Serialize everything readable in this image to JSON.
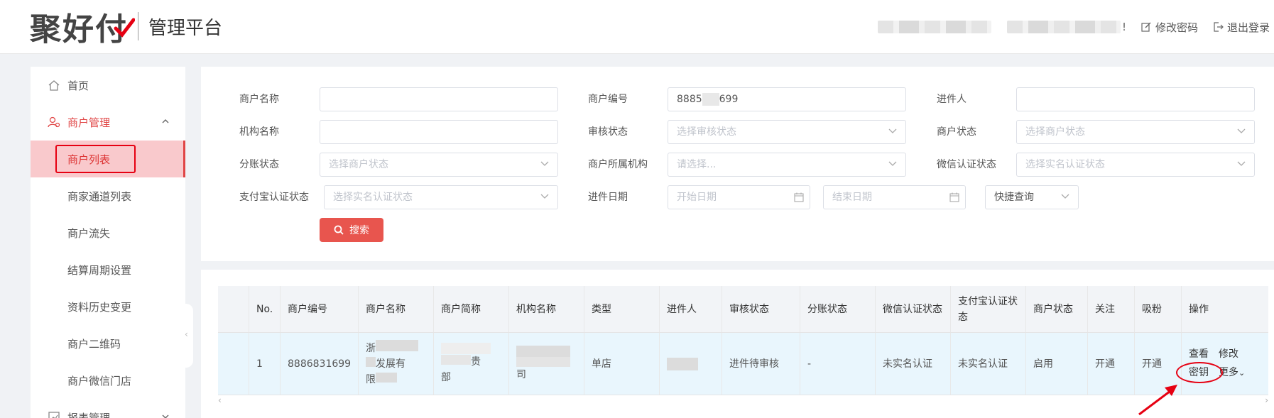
{
  "header": {
    "logo_text": "聚好付",
    "platform_title": "管理平台",
    "greeting_suffix": "!",
    "change_password": "修改密码",
    "logout": "退出登录"
  },
  "sidebar": {
    "home": "首页",
    "merchant_mgmt": "商户管理",
    "items": [
      "商户列表",
      "商家通道列表",
      "商户流失",
      "结算周期设置",
      "资料历史变更",
      "商户二维码",
      "商户微信门店"
    ],
    "report_mgmt": "报表管理"
  },
  "search": {
    "merchant_name_label": "商户名称",
    "merchant_no_label": "商户编号",
    "merchant_no_prefix": "8885",
    "merchant_no_suffix": "699",
    "applicant_label": "进件人",
    "org_name_label": "机构名称",
    "audit_status_label": "审核状态",
    "audit_status_ph": "选择审核状态",
    "merchant_status_label": "商户状态",
    "merchant_status_ph": "选择商户状态",
    "split_status_label": "分账状态",
    "split_status_ph": "选择商户状态",
    "belong_org_label": "商户所属机构",
    "belong_org_ph": "请选择...",
    "wechat_auth_label": "微信认证状态",
    "wechat_auth_ph": "选择实名认证状态",
    "alipay_auth_label": "支付宝认证状态",
    "alipay_auth_ph": "选择实名认证状态",
    "entry_date_label": "进件日期",
    "start_date_ph": "开始日期",
    "end_date_ph": "结束日期",
    "quick_query": "快捷查询",
    "search_button": "搜索"
  },
  "table": {
    "headers": [
      "No.",
      "商户编号",
      "商户名称",
      "商户简称",
      "机构名称",
      "类型",
      "进件人",
      "审核状态",
      "分账状态",
      "微信认证状态",
      "支付宝认证状态",
      "商户状态",
      "关注",
      "吸粉",
      "操作"
    ],
    "row": {
      "no": "1",
      "merchant_no": "8886831699",
      "name_line1": "浙",
      "name_line2": "发展有",
      "name_line3": "限",
      "short_line2": "贵",
      "short_line3": "部",
      "org_line3": "司",
      "type": "单店",
      "audit": "进件待审核",
      "split": "-",
      "wechat": "未实名认证",
      "alipay": "未实名认证",
      "status": "启用",
      "follow": "开通",
      "fans": "开通",
      "op_view": "查看",
      "op_edit": "修改",
      "op_key": "密钥",
      "op_more": "更多"
    }
  }
}
